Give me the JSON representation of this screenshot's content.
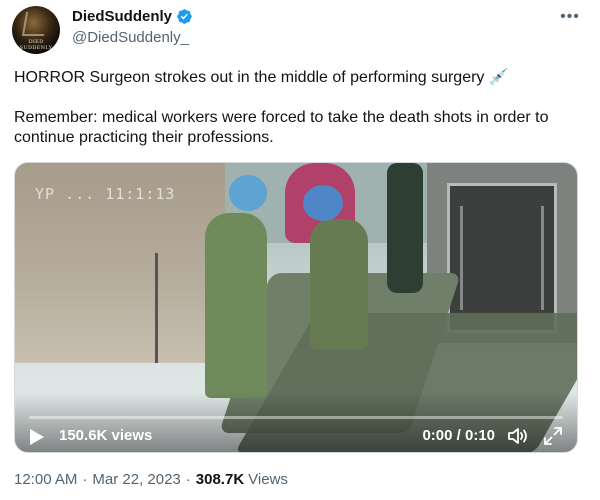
{
  "author": {
    "display_name": "DiedSuddenly",
    "handle": "@DiedSuddenly_",
    "avatar_text": "DIED SUDDENLY",
    "verified_color": "#1d9bf0"
  },
  "more_icon": "more-horizontal-icon",
  "tweet": {
    "line1": "HORROR Surgeon strokes out in the middle of performing surgery 💉",
    "line2": "Remember: medical workers were forced to take the death shots in order to continue practicing their professions."
  },
  "video": {
    "overlay_timestamp": "YP ... 11:1:13",
    "views_label": "150.6K views",
    "time_label": "0:00 / 0:10",
    "progress": 0,
    "icons": [
      "play-icon",
      "volume-icon",
      "fullscreen-icon"
    ]
  },
  "meta": {
    "time": "12:00 AM",
    "date": "Mar 22, 2023",
    "view_count": "308.7K",
    "views_word": "Views"
  }
}
